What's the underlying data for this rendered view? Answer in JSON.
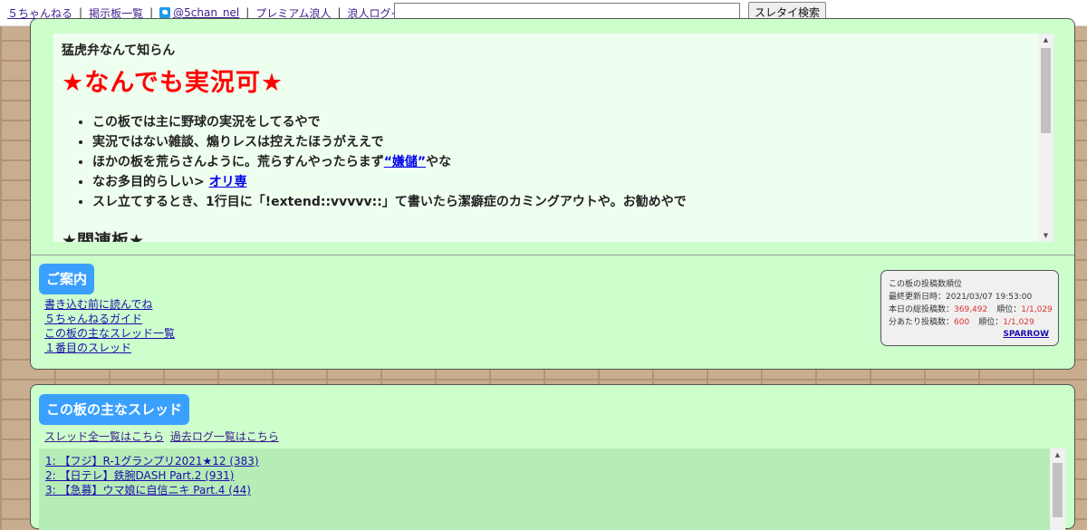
{
  "topbar": {
    "links": {
      "site": "５ちゃんねる",
      "board_list": "掲示板一覧",
      "twitter": "@5chan_nel",
      "premium": "プレミアム浪人",
      "login": "浪人ログイン"
    },
    "separator": "|",
    "search_button": "スレタイ検索",
    "search_value": ""
  },
  "header": {
    "subtitle": "猛虎弁なんて知らん",
    "board_title": "★なんでも実況可★",
    "rules": [
      {
        "text": "この板では主に野球の実況をしてるやで"
      },
      {
        "text": "実況ではない雑談、煽りレスは控えたほうがええで"
      },
      {
        "text_before": "ほかの板を荒らさんように。荒らすんやったらまず",
        "link": "“嫌儲”",
        "text_after": "やな"
      },
      {
        "text_before": "なお多目的らしい> ",
        "link": "オリ専"
      },
      {
        "text": "スレ立てするとき、1行目に「!extend::vvvvv::」て書いたら潔癖症のカミングアウトや。お勧めやで"
      }
    ],
    "related_heading": "★関連板★"
  },
  "guide": {
    "label": "ご案内",
    "links": [
      "書き込む前に読んでね",
      "５ちゃんねるガイド",
      "この板の主なスレッド一覧",
      "１番目のスレッド"
    ]
  },
  "stats": {
    "title": "この板の投稿数順位",
    "updated_label": "最終更新日時：",
    "updated_value": "2021/03/07 19:53:00",
    "today_label": "本日の総投稿数：",
    "today_value": "369,492",
    "rank_label": "順位：",
    "today_rank": "1/1,029",
    "per_min_label": "分あたり投稿数：",
    "per_min_value": "600",
    "per_min_rank": "1/1,029",
    "credit": "SPARROW"
  },
  "threads": {
    "label": "この板の主なスレッド",
    "all_link": "スレッド全一覧はこちら",
    "archive_link": "過去ログ一覧はこちら",
    "items": [
      "1: 【フジ】R-1グランプリ2021★12 (383)",
      "2: 【日テレ】鉄腕DASH Part.2 (931)",
      "3: 【急募】ウマ娘に自信ニキ Part.4 (44)"
    ]
  }
}
